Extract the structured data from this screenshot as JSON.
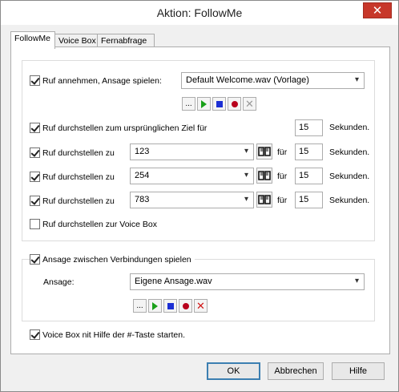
{
  "window": {
    "title": "Aktion: FollowMe",
    "close_label": "✕"
  },
  "tabs": [
    "FollowMe",
    "Voice Box",
    "Fernabfrage"
  ],
  "followme": {
    "answer": {
      "label": "Ruf annehmen, Ansage spielen:",
      "checked": true,
      "file": "Default Welcome.wav (Vorlage)",
      "browse": "..."
    },
    "original": {
      "label": "Ruf durchstellen zum ursprünglichen Ziel für",
      "checked": true,
      "seconds": "15",
      "unit": "Sekunden."
    },
    "forwards": [
      {
        "label": "Ruf durchstellen zu",
        "checked": true,
        "number": "123",
        "for": "für",
        "seconds": "15",
        "unit": "Sekunden."
      },
      {
        "label": "Ruf durchstellen zu",
        "checked": true,
        "number": "254",
        "for": "für",
        "seconds": "15",
        "unit": "Sekunden."
      },
      {
        "label": "Ruf durchstellen zu",
        "checked": true,
        "number": "783",
        "for": "für",
        "seconds": "15",
        "unit": "Sekunden."
      }
    ],
    "voicebox": {
      "label": "Ruf durchstellen zur Voice Box",
      "checked": false
    }
  },
  "between": {
    "label": "Ansage zwischen Verbindungen spielen",
    "checked": true,
    "ansage_label": "Ansage:",
    "file": "Eigene Ansage.wav",
    "browse": "..."
  },
  "hash_start": {
    "label": "Voice Box nit Hilfe der #-Taste starten.",
    "checked": true
  },
  "buttons": {
    "ok": "OK",
    "cancel": "Abbrechen",
    "help": "Hilfe"
  },
  "colors": {
    "close": "#c7372a",
    "play": "#1aa01a",
    "stop": "#1c2fd4",
    "record": "#b8001c",
    "delete_active": "#d01515"
  }
}
